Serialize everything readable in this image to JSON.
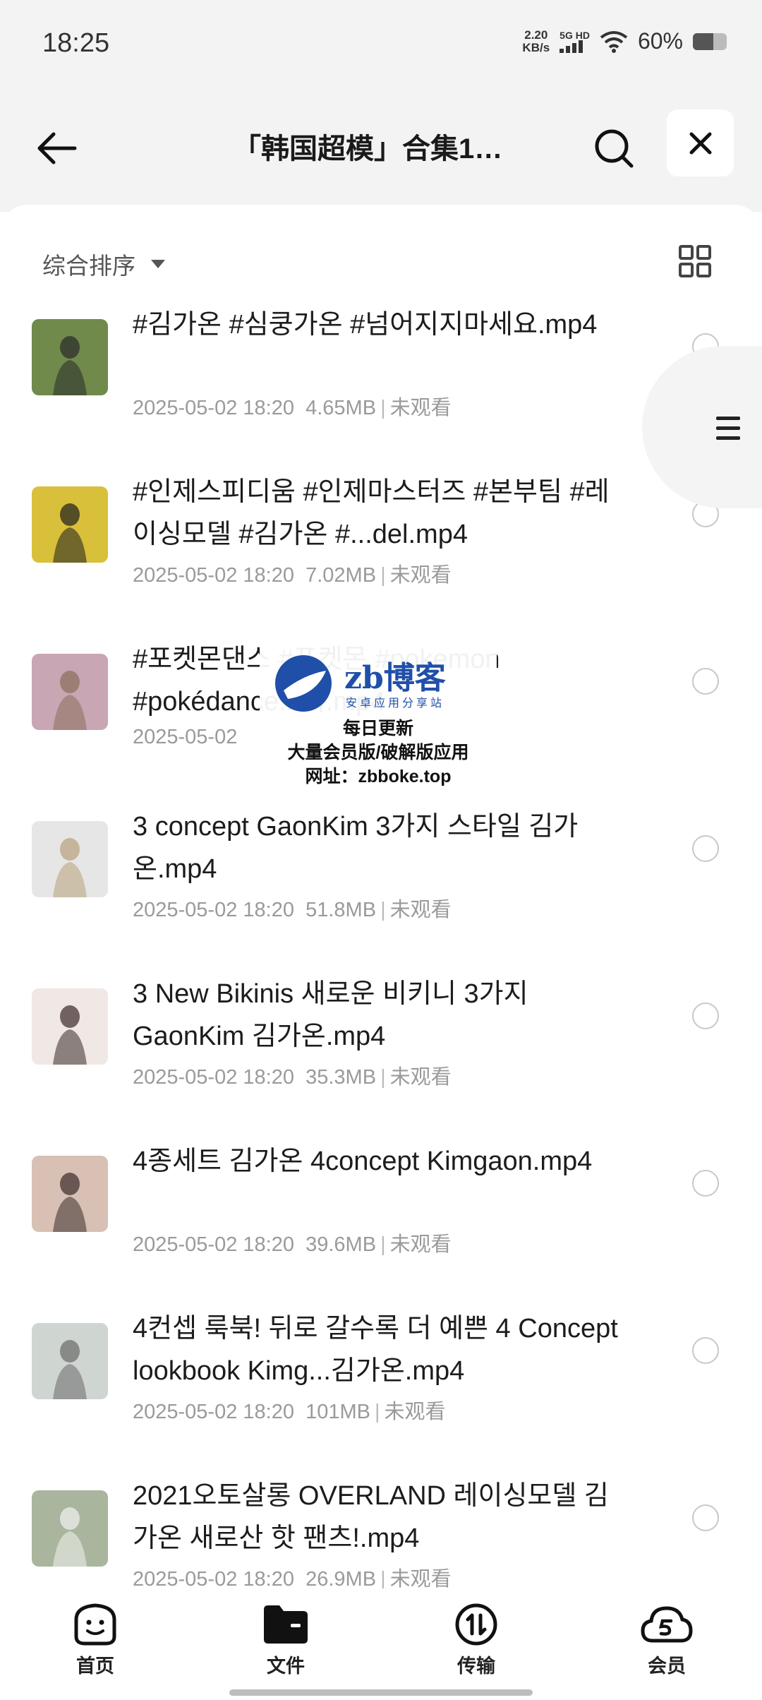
{
  "status": {
    "time": "18:25",
    "net_speed_value": "2.20",
    "net_speed_unit": "KB/s",
    "network_label_top": "5G HD",
    "battery_percent": "60%",
    "battery_level": 0.6
  },
  "header": {
    "title": "「韩国超模」合集1…"
  },
  "sort": {
    "label": "综合排序"
  },
  "files": [
    {
      "name": "#김가온 #심쿵가온 #넘어지지마세요.mp4",
      "date": "2025-05-02 18:20",
      "size": "4.65MB",
      "status": "未观看",
      "thumb_bg": "#6f8a4a",
      "thumb_fg": "#2a2a2a"
    },
    {
      "name": "#인제스피디움 #인제마스터즈 #본부팀 #레이싱모델 #김가온 #...del.mp4",
      "date": "2025-05-02 18:20",
      "size": "7.02MB",
      "status": "未观看",
      "thumb_bg": "#d9c03a",
      "thumb_fg": "#1d1d1d"
    },
    {
      "name": "#포켓몬댄스 #포켓몬 #pokemon #pokédance...지.mp4",
      "date": "2025-05-02",
      "size": "",
      "status": "",
      "thumb_bg": "#c9a6b4",
      "thumb_fg": "#8a6d5a"
    },
    {
      "name": "3 concept GaonKim 3가지 스타일 김가온.mp4",
      "date": "2025-05-02 18:20",
      "size": "51.8MB",
      "status": "未观看",
      "thumb_bg": "#e6e6e6",
      "thumb_fg": "#b6a07a"
    },
    {
      "name": "3 New Bikinis 새로운 비키니 3가지 GaonKim 김가온.mp4",
      "date": "2025-05-02 18:20",
      "size": "35.3MB",
      "status": "未观看",
      "thumb_bg": "#f0e8e4",
      "thumb_fg": "#3a2a2a"
    },
    {
      "name": "4종세트 김가온 4concept Kimgaon.mp4",
      "date": "2025-05-02 18:20",
      "size": "39.6MB",
      "status": "未观看",
      "thumb_bg": "#d8c0b4",
      "thumb_fg": "#3b2b2b"
    },
    {
      "name": "4컨셉 룩북! 뒤로 갈수록 더 예쁜 4 Concept lookbook Kimg...김가온.mp4",
      "date": "2025-05-02 18:20",
      "size": "101MB",
      "status": "未观看",
      "thumb_bg": "#cfd5d0",
      "thumb_fg": "#6a6a6a"
    },
    {
      "name": "2021오토살롱 OVERLAND 레이싱모델 김가온 새로산 핫 팬츠!.mp4",
      "date": "2025-05-02 18:20",
      "size": "26.9MB",
      "status": "未观看",
      "thumb_bg": "#a9b59c",
      "thumb_fg": "#f2f2f2"
    }
  ],
  "watermark": {
    "brand": "zb博客",
    "subtitle": "安卓应用分享站",
    "line1": "每日更新",
    "line2": "大量会员版/破解版应用",
    "line3": "网址：zbboke.top"
  },
  "nav": {
    "home": "首页",
    "files": "文件",
    "transfer": "传输",
    "vip": "会员"
  }
}
